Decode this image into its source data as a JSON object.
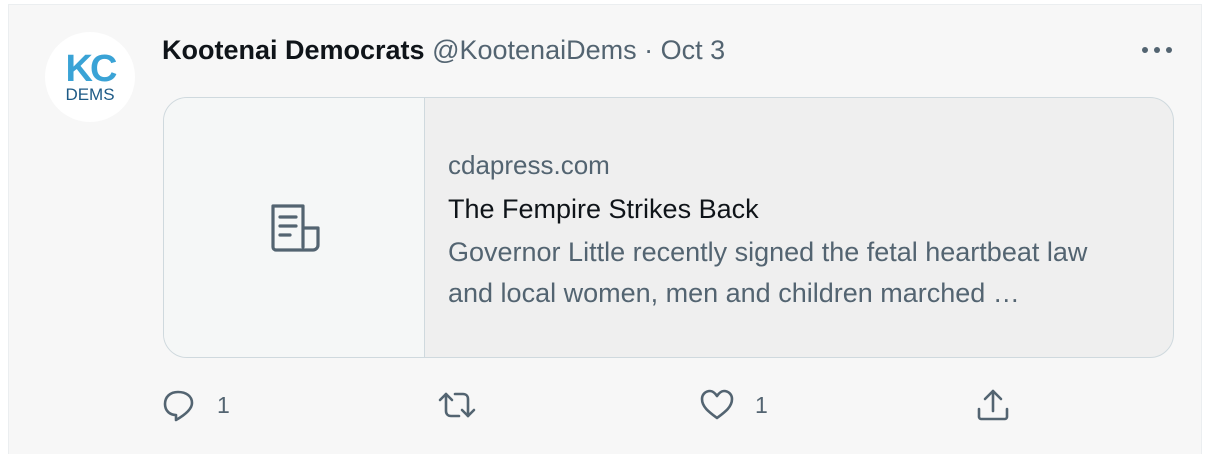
{
  "author": {
    "avatar_text_top": "KC",
    "avatar_text_bottom": "DEMS",
    "display_name": "Kootenai Democrats",
    "handle": "@KootenaiDems",
    "separator": "·",
    "date": "Oct 3"
  },
  "card": {
    "domain": "cdapress.com",
    "title": "The Fempire Strikes Back",
    "description": "Governor Little recently signed the fetal heartbeat law and local women, men and children marched …"
  },
  "actions": {
    "reply_count": "1",
    "retweet_count": "",
    "like_count": "1"
  },
  "icons": {
    "more": "more-icon",
    "article": "article-icon",
    "reply": "reply-icon",
    "retweet": "retweet-icon",
    "like": "heart-icon",
    "share": "share-icon"
  },
  "colors": {
    "text_primary": "#0f1419",
    "text_secondary": "#536471",
    "brand_blue": "#3aa3d6"
  }
}
